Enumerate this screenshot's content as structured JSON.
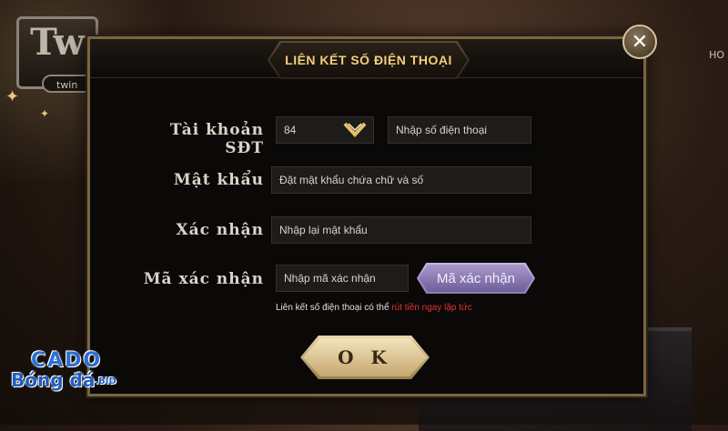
{
  "background": {
    "logo_text": "Tw",
    "logo_sub": "twin",
    "right_label": "HO"
  },
  "dialog": {
    "title": "LIÊN KẾT SỐ ĐIỆN THOẠI",
    "close_icon": "close-icon"
  },
  "form": {
    "phone_label": "Tài khoản SĐT",
    "country_code": "84",
    "phone_placeholder": "Nhập số điện thoại",
    "password_label": "Mật khẩu",
    "password_placeholder": "Đặt mật khẩu chứa chữ và số",
    "confirm_label": "Xác nhận",
    "confirm_placeholder": "Nhập lại mật khẩu",
    "captcha_label": "Mã xác nhận",
    "captcha_placeholder": "Nhập mã xác nhận",
    "captcha_button": "Mã xác nhận",
    "notice_prefix": "Liên kết số điện thoại có thể ",
    "notice_highlight": "rút tiền ngay lập tức",
    "ok_button": "O K"
  },
  "watermark": {
    "top": "CADO",
    "bottom": "Bóng đá",
    "suffix": ".BID"
  },
  "colors": {
    "title_gold": "#f2cf7c",
    "notice_red": "#e5322f",
    "captcha_purple": "#8d7cb4"
  }
}
